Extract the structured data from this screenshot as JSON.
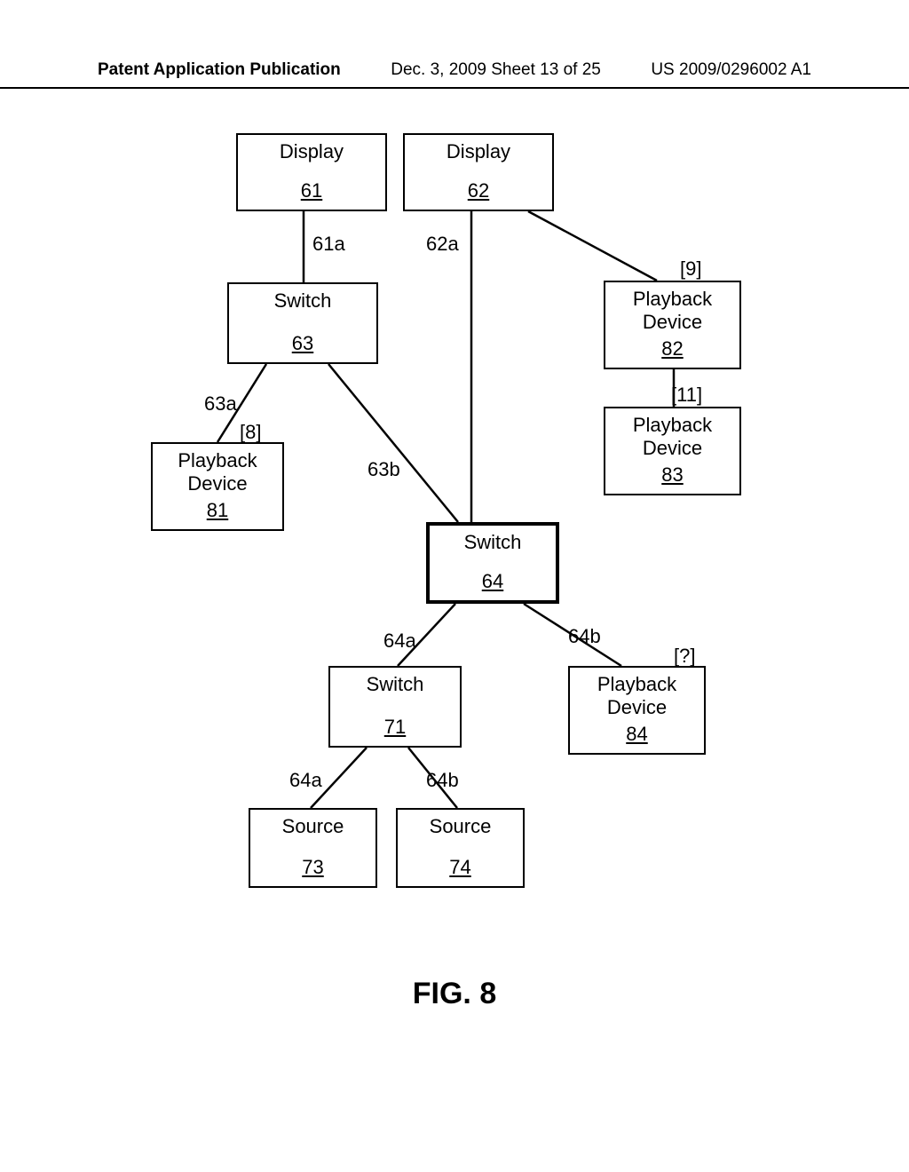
{
  "header": {
    "left": "Patent Application Publication",
    "center": "Dec. 3, 2009  Sheet 13 of 25",
    "right": "US 2009/0296002 A1"
  },
  "figure_label": "FIG. 8",
  "nodes": {
    "n61": {
      "label": "Display",
      "ref": "61"
    },
    "n62": {
      "label": "Display",
      "ref": "62"
    },
    "n63": {
      "label": "Switch",
      "ref": "63"
    },
    "n82": {
      "label": "Playback Device",
      "ref": "82"
    },
    "n81": {
      "label": "Playback Device",
      "ref": "81"
    },
    "n83": {
      "label": "Playback Device",
      "ref": "83"
    },
    "n64": {
      "label": "Switch",
      "ref": "64"
    },
    "n71": {
      "label": "Switch",
      "ref": "71"
    },
    "n84": {
      "label": "Playback Device",
      "ref": "84"
    },
    "n73": {
      "label": "Source",
      "ref": "73"
    },
    "n74": {
      "label": "Source",
      "ref": "74"
    }
  },
  "edge_labels": {
    "e61a": "61a",
    "e62a": "62a",
    "e63a": "63a",
    "e63b": "63b",
    "e64a": "64a",
    "e64b": "64b",
    "e71a": "64a",
    "e71b": "64b"
  },
  "annotations": {
    "a8": "[8]",
    "a9": "[9]",
    "a11": "[11]",
    "aq": "[?]"
  }
}
